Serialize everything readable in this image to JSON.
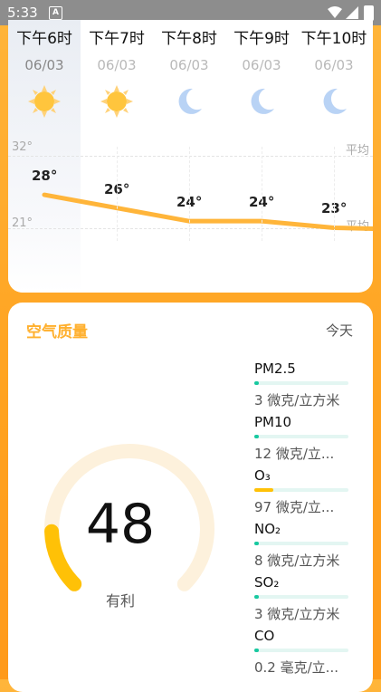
{
  "status_bar": {
    "time": "5:33",
    "notif_glyph": "A"
  },
  "hourly": [
    {
      "time": "下午6时",
      "date": "06/03",
      "icon": "sun-icon",
      "temp": "28°",
      "active": true
    },
    {
      "time": "下午7时",
      "date": "06/03",
      "icon": "sun-icon",
      "temp": "26°"
    },
    {
      "time": "下午8时",
      "date": "06/03",
      "icon": "moon-icon",
      "temp": "24°"
    },
    {
      "time": "下午9时",
      "date": "06/03",
      "icon": "moon-icon",
      "temp": "24°"
    },
    {
      "time": "下午10时",
      "date": "06/03",
      "icon": "moon-icon",
      "temp": "23°"
    }
  ],
  "chart": {
    "max_label": "32°",
    "min_label": "21°",
    "avg_label_top": "平均",
    "avg_label_bottom": "平均",
    "line_color": "#ffb53a"
  },
  "aqi": {
    "title": "空气质量",
    "period": "今天",
    "value": "48",
    "level": "有利",
    "gauge_fraction": 0.16,
    "pollutants": [
      {
        "name": "PM2.5",
        "value": "3 微克/立方米",
        "level": 0.03,
        "color": "#18c9a0"
      },
      {
        "name": "PM10",
        "value": "12 微克/立...",
        "level": 0.04,
        "color": "#18c9a0"
      },
      {
        "name": "O₃",
        "value": "97 微克/立...",
        "level": 0.2,
        "color": "#ffc107"
      },
      {
        "name": "NO₂",
        "value": "8 微克/立方米",
        "level": 0.03,
        "color": "#18c9a0"
      },
      {
        "name": "SO₂",
        "value": "3 微克/立方米",
        "level": 0.03,
        "color": "#18c9a0"
      },
      {
        "name": "CO",
        "value": "0.2 毫克/立...",
        "level": 0.03,
        "color": "#18c9a0"
      }
    ]
  }
}
